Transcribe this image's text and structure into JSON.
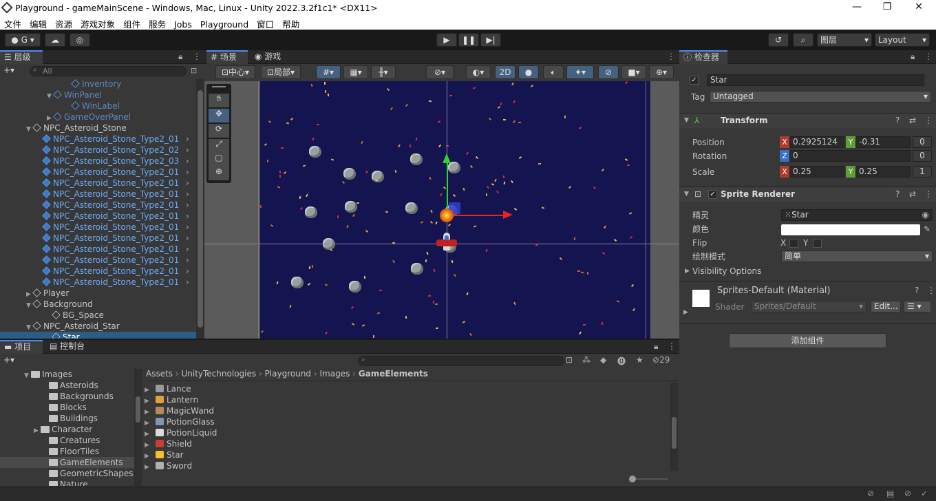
{
  "window": {
    "title": "Playground - gameMainScene - Windows, Mac, Linux - Unity 2022.3.2f1c1* <DX11>",
    "minimize": "—",
    "maximize": "❐",
    "close": "✕"
  },
  "menu": [
    "文件",
    "编辑",
    "资源",
    "游戏对象",
    "组件",
    "服务",
    "Jobs",
    "Playground",
    "窗口",
    "帮助"
  ],
  "toolbar": {
    "account": "G",
    "layers": "图层",
    "layout": "Layout"
  },
  "hierarchy": {
    "tab": "层级",
    "search_placeholder": "All",
    "rows": [
      {
        "label": "Inventory",
        "indent": 104,
        "arrow": "",
        "cls": "fblue",
        "cube": "bo"
      },
      {
        "label": "WinPanel",
        "indent": 78,
        "arrow": "▼",
        "cls": "fblue",
        "cube": "bo"
      },
      {
        "label": "WinLabel",
        "indent": 104,
        "arrow": "",
        "cls": "fblue",
        "cube": "bo"
      },
      {
        "label": "GameOverPanel",
        "indent": 78,
        "arrow": "▶",
        "cls": "fblue",
        "cube": "bo"
      },
      {
        "label": "NPC_Asteroid_Stone",
        "indent": 48,
        "arrow": "▼",
        "cls": "",
        "cube": ""
      },
      {
        "label": "NPC_Asteroid_Stone_Type2_01",
        "indent": 62,
        "arrow": "",
        "cls": "blue",
        "cube": "b",
        "more": true
      },
      {
        "label": "NPC_Asteroid_Stone_Type2_02",
        "indent": 62,
        "arrow": "",
        "cls": "blue",
        "cube": "b",
        "more": true
      },
      {
        "label": "NPC_Asteroid_Stone_Type2_03",
        "indent": 62,
        "arrow": "",
        "cls": "blue",
        "cube": "b",
        "more": true
      },
      {
        "label": "NPC_Asteroid_Stone_Type2_01",
        "indent": 62,
        "arrow": "",
        "cls": "blue",
        "cube": "b",
        "more": true
      },
      {
        "label": "NPC_Asteroid_Stone_Type2_01",
        "indent": 62,
        "arrow": "",
        "cls": "blue",
        "cube": "b",
        "more": true
      },
      {
        "label": "NPC_Asteroid_Stone_Type2_01",
        "indent": 62,
        "arrow": "",
        "cls": "blue",
        "cube": "b",
        "more": true
      },
      {
        "label": "NPC_Asteroid_Stone_Type2_01",
        "indent": 62,
        "arrow": "",
        "cls": "blue",
        "cube": "b",
        "more": true
      },
      {
        "label": "NPC_Asteroid_Stone_Type2_01",
        "indent": 62,
        "arrow": "",
        "cls": "blue",
        "cube": "b",
        "more": true
      },
      {
        "label": "NPC_Asteroid_Stone_Type2_01",
        "indent": 62,
        "arrow": "",
        "cls": "blue",
        "cube": "b",
        "more": true
      },
      {
        "label": "NPC_Asteroid_Stone_Type2_01",
        "indent": 62,
        "arrow": "",
        "cls": "blue",
        "cube": "b",
        "more": true
      },
      {
        "label": "NPC_Asteroid_Stone_Type2_01",
        "indent": 62,
        "arrow": "",
        "cls": "blue",
        "cube": "b",
        "more": true
      },
      {
        "label": "NPC_Asteroid_Stone_Type2_01",
        "indent": 62,
        "arrow": "",
        "cls": "blue",
        "cube": "b",
        "more": true
      },
      {
        "label": "NPC_Asteroid_Stone_Type2_01",
        "indent": 62,
        "arrow": "",
        "cls": "blue",
        "cube": "b",
        "more": true
      },
      {
        "label": "NPC_Asteroid_Stone_Type2_01",
        "indent": 62,
        "arrow": "",
        "cls": "blue",
        "cube": "b",
        "more": true
      },
      {
        "label": "Player",
        "indent": 48,
        "arrow": "▶",
        "cls": "",
        "cube": ""
      },
      {
        "label": "Background",
        "indent": 48,
        "arrow": "▼",
        "cls": "",
        "cube": ""
      },
      {
        "label": "BG_Space",
        "indent": 76,
        "arrow": "",
        "cls": "",
        "cube": ""
      },
      {
        "label": "NPC_Asteroid_Star",
        "indent": 48,
        "arrow": "▼",
        "cls": "",
        "cube": ""
      },
      {
        "label": "Star",
        "indent": 76,
        "arrow": "",
        "cls": "",
        "cube": "",
        "selected": true
      }
    ]
  },
  "scene": {
    "tab_scene": "场景",
    "tab_game": "游戏",
    "pivot": "中心",
    "space": "局部",
    "mode2d": "2D"
  },
  "inspector": {
    "tab": "检查器",
    "name": "Star",
    "tag_label": "Tag",
    "tag_value": "Untagged",
    "transform": {
      "title": "Transform",
      "position_label": "Position",
      "rotation_label": "Rotation",
      "scale_label": "Scale",
      "pos_x": "0.2925124",
      "pos_y": "-0.31",
      "pos_z": "0",
      "rot_z": "0",
      "scale_x": "0.25",
      "scale_y": "0.25",
      "scale_z": "1"
    },
    "sprite_renderer": {
      "title": "Sprite Renderer",
      "sprite_label": "精灵",
      "sprite_value": "Star",
      "color_label": "颜色",
      "flip_label": "Flip",
      "flip_x": "X",
      "flip_y": "Y",
      "draw_mode_label": "绘制模式",
      "draw_mode_value": "简单"
    },
    "visibility": "Visibility Options",
    "material": {
      "title": "Sprites-Default (Material)",
      "shader_label": "Shader",
      "shader_value": "Sprites/Default",
      "edit": "Edit..."
    },
    "add_component": "添加组件"
  },
  "project": {
    "tab_project": "项目",
    "tab_console": "控制台",
    "count": "29",
    "breadcrumb": [
      "Assets",
      "UnityTechnologies",
      "Playground",
      "Images",
      "GameElements"
    ],
    "tree": [
      {
        "label": "Images",
        "indent": 48,
        "arrow": "▼"
      },
      {
        "label": "Asteroids",
        "indent": 74,
        "arrow": ""
      },
      {
        "label": "Backgrounds",
        "indent": 74,
        "arrow": ""
      },
      {
        "label": "Blocks",
        "indent": 74,
        "arrow": ""
      },
      {
        "label": "Buildings",
        "indent": 74,
        "arrow": ""
      },
      {
        "label": "Character",
        "indent": 62,
        "arrow": "▶"
      },
      {
        "label": "Creatures",
        "indent": 74,
        "arrow": ""
      },
      {
        "label": "FloorTiles",
        "indent": 74,
        "arrow": ""
      },
      {
        "label": "GameElements",
        "indent": 74,
        "arrow": "",
        "selected": true
      },
      {
        "label": "GeometricShapes",
        "indent": 74,
        "arrow": ""
      },
      {
        "label": "Nature",
        "indent": 74,
        "arrow": ""
      }
    ],
    "assets": [
      {
        "label": "Lance",
        "color": "#9a9a9a"
      },
      {
        "label": "Lantern",
        "color": "#e0a040"
      },
      {
        "label": "MagicWand",
        "color": "#b58a5a"
      },
      {
        "label": "PotionGlass",
        "color": "#7f98b0"
      },
      {
        "label": "PotionLiquid",
        "color": "#dcdcdc"
      },
      {
        "label": "Shield",
        "color": "#c8402c"
      },
      {
        "label": "Star",
        "color": "#f5c02a"
      },
      {
        "label": "Sword",
        "color": "#b0b0b0"
      }
    ]
  }
}
